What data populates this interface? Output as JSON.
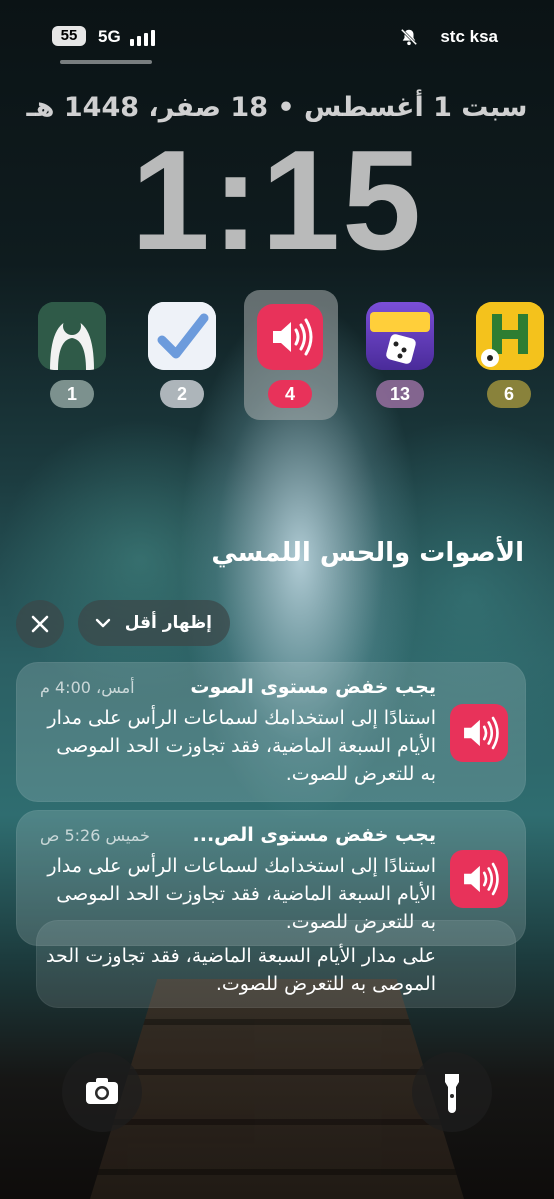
{
  "status_bar": {
    "battery": "55",
    "network": "5G",
    "carrier": "stc ksa"
  },
  "lock_screen": {
    "date": "سبت 1 أغسطس • 18 صفر، 1448 هـ",
    "time": "1:15"
  },
  "app_badges": [
    {
      "name": "app-1",
      "count": "1"
    },
    {
      "name": "app-2",
      "count": "2"
    },
    {
      "name": "sounds-haptics",
      "count": "4"
    },
    {
      "name": "party-star",
      "count": "13"
    },
    {
      "name": "hungry-app",
      "count": "6"
    }
  ],
  "notification_group": {
    "title": "الأصوات والحس اللمسي",
    "show_less": "إظهار أقل"
  },
  "notifications": [
    {
      "title": "يجب خفض مستوى الصوت",
      "time": "أمس، 4:00 م",
      "body": "استنادًا إلى استخدامك لسماعات الرأس على مدار الأيام السبعة الماضية، فقد تجاوزت الحد الموصى به للتعرض للصوت."
    },
    {
      "title": "يجب خفض مستوى الص...",
      "time": "خميس 5:26 ص",
      "body": "استنادًا إلى استخدامك لسماعات الرأس على مدار الأيام السبعة الماضية، فقد تجاوزت الحد الموصى به للتعرض للصوت."
    }
  ],
  "stacked_notification": {
    "body": "على مدار الأيام السبعة الماضية، فقد تجاوزت الحد الموصى به للتعرض للصوت."
  },
  "colors": {
    "sounds_icon": "#e8325a",
    "badge_selected": "#e8325a"
  }
}
